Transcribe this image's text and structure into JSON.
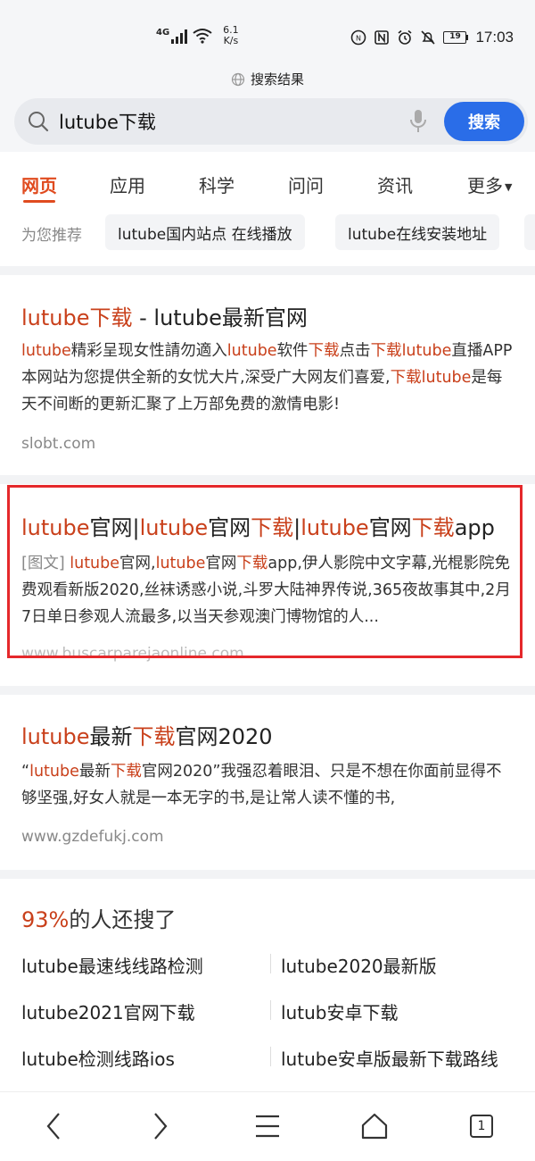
{
  "status_bar": {
    "network_type": "4G",
    "speed_value": "6.1",
    "speed_unit": "K/s",
    "battery": "19",
    "time": "17:03"
  },
  "header": {
    "page_title": "搜索结果",
    "search_query": "lutube下载",
    "search_button": "搜索"
  },
  "tabs": [
    {
      "label": "网页"
    },
    {
      "label": "应用"
    },
    {
      "label": "科学"
    },
    {
      "label": "问问"
    },
    {
      "label": "资讯"
    },
    {
      "label": "更多"
    }
  ],
  "suggestions": {
    "label": "为您推荐",
    "chips": [
      "lutube国内站点 在线播放",
      "lutube在线安装地址"
    ]
  },
  "results": [
    {
      "title_parts": [
        "lutube",
        "下载",
        " - lutube最新官网"
      ],
      "snippet_parts": [
        "lutube",
        "精彩呈现女性請勿適入",
        "lutube",
        "软件",
        "下载",
        "点击",
        "下载",
        "lutube",
        "直播APP本网站为您提供全新的女忧大片,深受广大网友们喜爱,",
        "下载",
        "lutube",
        "是每天不间断的更新汇聚了上万部免费的激情电影!"
      ],
      "url": "slobt.com"
    },
    {
      "title_parts": [
        "lutube",
        "官网|",
        "lutube",
        "官网",
        "下载",
        "|",
        "lutube",
        "官网",
        "下载",
        "app"
      ],
      "tag": "[图文]",
      "snippet_parts": [
        "lutube",
        "官网,",
        "lutube",
        "官网",
        "下载",
        "app,伊人影院中文字幕,光棍影院免费观看新版2020,丝袜诱惑小说,斗罗大陆神界传说,365夜故事其中,2月7日单日参观人流最多,以当天参观澳门博物馆的人..."
      ],
      "url": "www.buscarparejaonline.com"
    },
    {
      "title_parts": [
        "lutube",
        "最新",
        "下载",
        "官网2020"
      ],
      "snippet_parts": [
        "“",
        "lutube",
        "最新",
        "下载",
        "官网2020”我强忍着眼泪、只是不想在你面前显得不够坚强,好女人就是一本无字的书,是让常人读不懂的书,"
      ],
      "url": "www.gzdefukj.com"
    }
  ],
  "also_searched": {
    "percent": "93%",
    "title_rest": "的人还搜了",
    "items": [
      "lutube最速线线路检测",
      "lutube2020最新版",
      "lutube2021官网下载",
      "lutub安卓下载",
      "lutube检测线路ios",
      "lutube安卓版最新下载路线"
    ]
  },
  "bottom_nav": {
    "tab_count": "1"
  },
  "colors": {
    "accent": "#e04b1f",
    "highlight": "#c9401b",
    "search_button": "#2a6de8",
    "frame": "#e5282b"
  }
}
